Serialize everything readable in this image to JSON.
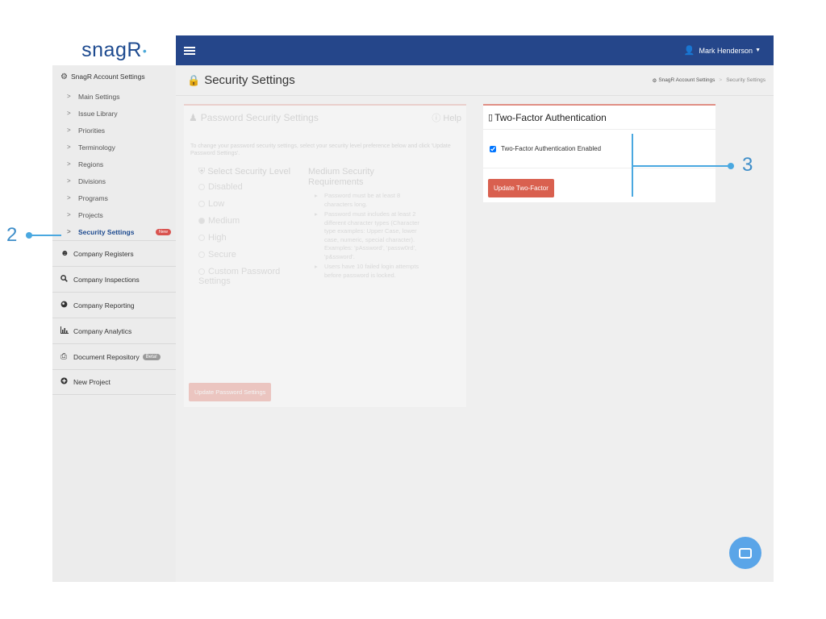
{
  "app": {
    "logo_text": "snagR"
  },
  "topbar": {
    "user_name": "Mark Henderson"
  },
  "sidebar": {
    "account_settings_label": "SnagR Account Settings",
    "sub_items": [
      {
        "label": "Main Settings"
      },
      {
        "label": "Issue Library"
      },
      {
        "label": "Priorities"
      },
      {
        "label": "Terminology"
      },
      {
        "label": "Regions"
      },
      {
        "label": "Divisions"
      },
      {
        "label": "Programs"
      },
      {
        "label": "Projects"
      },
      {
        "label": "Security Settings",
        "badge": "New"
      }
    ],
    "nav_items": [
      {
        "label": "Company Registers",
        "icon": "users-icon"
      },
      {
        "label": "Company Inspections",
        "icon": "search-icon"
      },
      {
        "label": "Company Reporting",
        "icon": "globe-icon"
      },
      {
        "label": "Company Analytics",
        "icon": "bar-chart-icon"
      },
      {
        "label": "Document Repository",
        "icon": "document-icon",
        "badge": "Beta!"
      },
      {
        "label": "New Project",
        "icon": "plus-circle-icon"
      }
    ]
  },
  "page": {
    "title": "Security Settings",
    "breadcrumb": {
      "parent": "SnagR Account Settings",
      "current": "Security Settings"
    }
  },
  "password_panel": {
    "title": "Password Security Settings",
    "help_label": "Help",
    "intro": "To change your password security settings, select your security level preference below and click 'Update Password Settings'.",
    "level_title": "Select Security Level",
    "levels": [
      "Disabled",
      "Low",
      "Medium",
      "High",
      "Secure",
      "Custom Password Settings"
    ],
    "selected_level": "Medium",
    "req_title": "Medium Security Requirements",
    "requirements": [
      "Password must be at least 8 characters long.",
      "Password must includes at least 2 different character types (Character type examples: Upper Case, lower case, numeric, special character). Examples: 'pAssword', 'passw0rd', 'p&ssword'.",
      "Users have 10 failed login attempts before password is locked."
    ],
    "button_label": "Update Password Settings"
  },
  "two_factor_panel": {
    "title": "Two-Factor Authentication",
    "checkbox_label": "Two-Factor Authentication Enabled",
    "checked": true,
    "button_label": "Update Two-Factor"
  },
  "annotations": {
    "left_number": "2",
    "right_number": "3"
  },
  "colors": {
    "topbar": "#25468a",
    "accent_button": "#d9604f",
    "panel_border": "#e08f85",
    "annotation": "#4aa8e0",
    "chat_bubble": "#5aa5e8"
  }
}
